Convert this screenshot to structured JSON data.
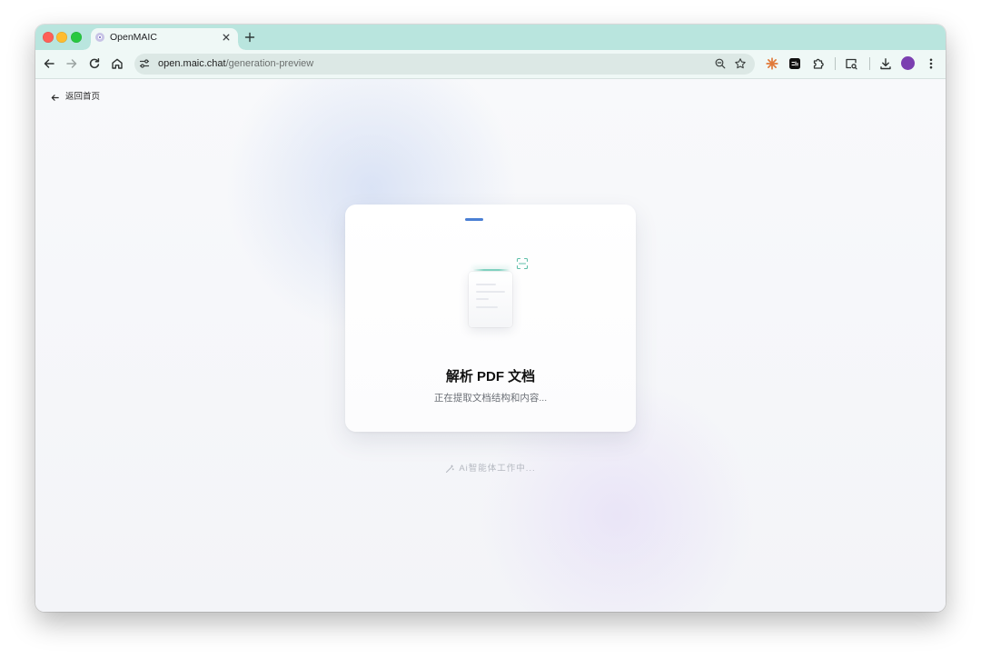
{
  "browser": {
    "window_controls": [
      "close-light",
      "minimize-light",
      "zoom-light"
    ],
    "tab": {
      "favicon": "openmaic-logo-icon",
      "title": "OpenMAIC",
      "close_icon": "close-icon"
    },
    "new_tab_icon": "plus-icon",
    "nav": {
      "back_icon": "arrow-left-icon",
      "forward_icon": "arrow-right-icon",
      "reload_icon": "reload-icon",
      "home_icon": "home-icon"
    },
    "address": {
      "site_info_icon": "tune-icon",
      "host": "open.maic.chat",
      "path": "/generation-preview",
      "zoom_icon": "zoom-icon",
      "bookmark_icon": "star-icon"
    },
    "extensions": [
      "spark-extension-icon",
      "black-square-extension-icon",
      "puzzle-icon"
    ],
    "tab_search_icon": "tab-search-icon",
    "download_icon": "download-icon",
    "profile_icon": "avatar-icon",
    "menu_icon": "kebab-menu-icon"
  },
  "page": {
    "back_link": {
      "icon": "arrow-left-icon",
      "label": "返回首页"
    },
    "card": {
      "step_indicator": "progress-step-bar",
      "illustration": "document-scan-illustration",
      "scan_icon": "scan-icon",
      "title": "解析 PDF 文档",
      "subtitle": "正在提取文档结构和内容..."
    },
    "status": {
      "icon": "magic-wand-icon",
      "label": "Ai智能体工作中..."
    }
  },
  "colors": {
    "tabstrip": "#b9e5de",
    "toolbar": "#eff8f6",
    "omnibox": "#dce8e5",
    "accent": "#4a7fd4",
    "scan": "#7fd1bf",
    "avatar": "#7b3fb0",
    "spark": "#e07a3a",
    "text": "#1a1a1a",
    "muted": "#6b6f76",
    "faint": "#b4b8c0"
  }
}
